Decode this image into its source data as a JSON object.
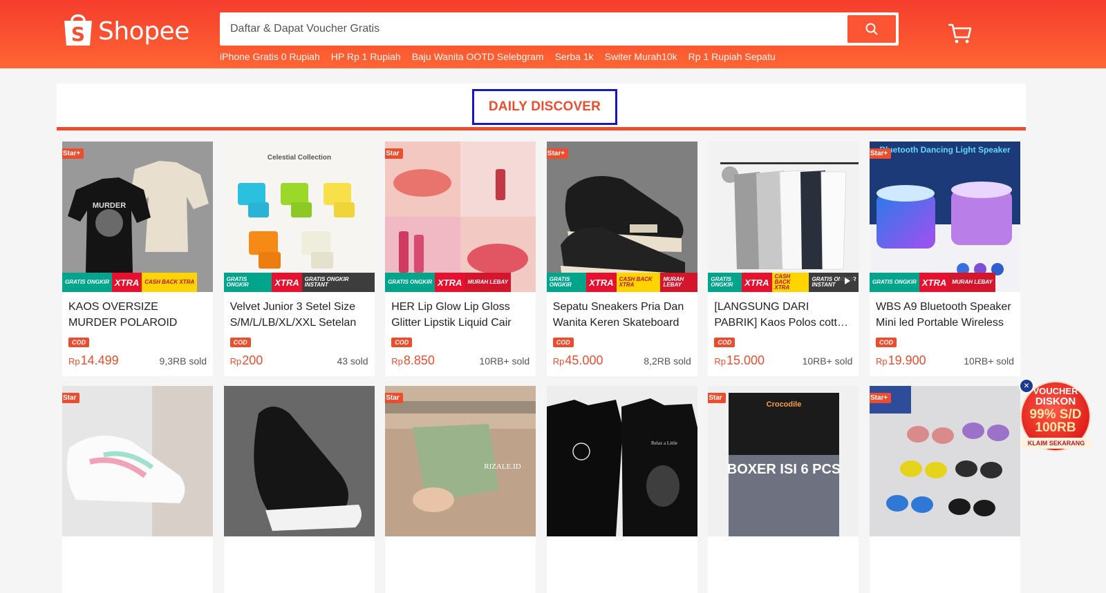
{
  "header": {
    "logo_text": "Shopee",
    "search_placeholder": "Daftar & Dapat Voucher Gratis",
    "hot_keywords": [
      "iPhone Gratis 0 Rupiah",
      "HP Rp 1 Rupiah",
      "Baju Wanita OOTD Selebgram",
      "Serba 1k",
      "Switer Murah10k",
      "Rp 1 Rupiah Sepatu"
    ]
  },
  "section": {
    "title": "DAILY DISCOVER"
  },
  "products": [
    {
      "name": "KAOS OVERSIZE MURDER POLAROID",
      "star": "Star+",
      "currency": "Rp",
      "price": "14.499",
      "sold": "9,3RB sold",
      "badges": [
        "GRATIS ONGKIR",
        "XTRA",
        "CASH BACK XTRA"
      ],
      "cod": "COD"
    },
    {
      "name": "Velvet Junior 3 Setel Size S/M/L/LB/XL/XXL Setelan",
      "star": "",
      "currency": "Rp",
      "price": "200",
      "sold": "43 sold",
      "badges": [
        "GRATIS ONGKIR",
        "XTRA",
        "GRATIS ONGKIR INSTANT"
      ],
      "cod": "COD"
    },
    {
      "name": "HER Lip Glow Lip Gloss Glitter Lipstik Liquid Cair",
      "star": "Star",
      "currency": "Rp",
      "price": "8.850",
      "sold": "10RB+ sold",
      "badges": [
        "GRATIS ONGKIR",
        "XTRA",
        "MURAH LEBAY"
      ],
      "cod": "COD"
    },
    {
      "name": "Sepatu Sneakers Pria Dan Wanita Keren Skateboard",
      "star": "Star+",
      "currency": "Rp",
      "price": "45.000",
      "sold": "8,2RB sold",
      "badges": [
        "GRATIS ONGKIR",
        "XTRA",
        "CASH BACK XTRA",
        "MURAH LEBAY"
      ],
      "cod": "COD"
    },
    {
      "name": "[LANGSUNG DARI PABRIK] Kaos Polos cotton combed",
      "star": "",
      "currency": "Rp",
      "price": "15.000",
      "sold": "10RB+ sold",
      "badges": [
        "GRATIS ONGKIR",
        "XTRA",
        "CASH BACK XTRA",
        "GRATIS ONGKIR INSTANT"
      ],
      "cod": "COD"
    },
    {
      "name": "WBS A9 Bluetooth Speaker Mini led Portable Wireless",
      "star": "Star+",
      "currency": "Rp",
      "price": "19.900",
      "sold": "10RB+ sold",
      "badges": [
        "GRATIS ONGKIR",
        "XTRA",
        "MURAH LEBAY"
      ],
      "cod": "COD"
    }
  ],
  "products_row2": [
    {
      "star": "Star",
      "image_text": ""
    },
    {
      "star": "",
      "image_text": ""
    },
    {
      "star": "Star",
      "image_text": "RIZALE.ID"
    },
    {
      "star": "",
      "image_text": "Relax a Little"
    },
    {
      "star": "Star",
      "image_text": "BOXER ISI 6 PCS"
    },
    {
      "star": "Star+",
      "image_text": ""
    }
  ],
  "image_texts": {
    "celestial": "Celestial Collection",
    "speaker": "Bluetooth Dancing Light Speaker",
    "crocodile": "Crocodile"
  },
  "floating_voucher": {
    "line1": "VOUCHER",
    "line2": "DISKON",
    "line3": "99% S/D",
    "line4": "100RB",
    "claim": "KLAIM SEKARANG"
  },
  "colors": {
    "brand": "#ee4d2d",
    "header_top": "#f53d2d",
    "header_bottom": "#ff6533",
    "highlight_box": "#1616c8"
  },
  "icons": {
    "search": "search-icon",
    "cart": "cart-icon",
    "logo": "shopee-bag-icon",
    "close": "close-icon"
  }
}
